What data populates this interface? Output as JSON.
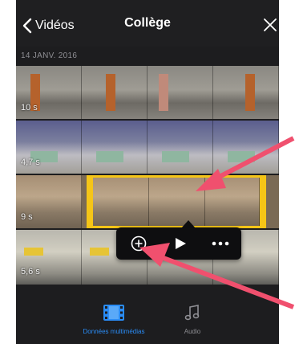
{
  "header": {
    "back_label": "Vidéos",
    "title": "Collège"
  },
  "timeline": {
    "date": "14 JANV. 2016",
    "clips": [
      {
        "duration": "10 s"
      },
      {
        "duration": "4,7 s"
      },
      {
        "duration": "9 s"
      },
      {
        "duration": "5,6 s"
      }
    ]
  },
  "tabs": [
    {
      "label": "Données multimédias",
      "icon": "film-icon",
      "active": true
    },
    {
      "label": "Audio",
      "icon": "music-note-icon",
      "active": false
    }
  ],
  "colors": {
    "accent": "#2a8cf6",
    "selection": "#f5c517",
    "annotation": "#f0506e"
  }
}
